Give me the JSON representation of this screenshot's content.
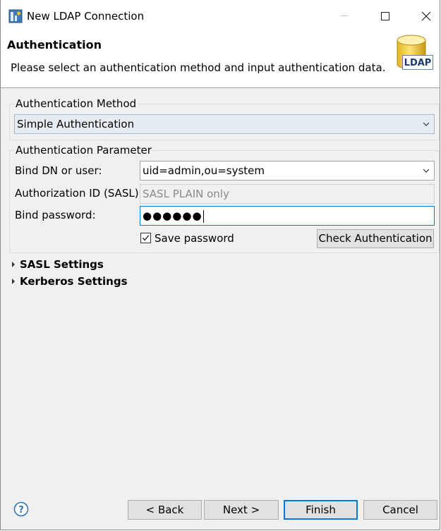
{
  "window": {
    "title": "New LDAP Connection"
  },
  "header": {
    "title": "Authentication",
    "description": "Please select an authentication method and input authentication data.",
    "logo_text": "LDAP"
  },
  "auth_method": {
    "group_label": "Authentication Method",
    "selected": "Simple Authentication"
  },
  "auth_params": {
    "group_label": "Authentication Parameter",
    "bind_dn_label": "Bind DN or user:",
    "bind_dn_value": "uid=admin,ou=system",
    "sasl_label": "Authorization ID (SASL):",
    "sasl_placeholder": "SASL PLAIN only",
    "password_label": "Bind password:",
    "password_value": "●●●●●●",
    "save_password_label": "Save password",
    "save_password_checked": true,
    "check_button_label": "Check Authentication"
  },
  "sections": {
    "sasl_label": "SASL Settings",
    "kerberos_label": "Kerberos Settings"
  },
  "footer": {
    "back_label": "< Back",
    "next_label": "Next >",
    "finish_label": "Finish",
    "cancel_label": "Cancel"
  },
  "colors": {
    "accent": "#0078d7",
    "combo_bg": "#e5ecf2",
    "dialog_bg": "#f0f0f0"
  },
  "icons": {
    "app": "ldap-connection-icon",
    "minimize": "minimize-icon",
    "maximize": "maximize-icon",
    "close": "close-icon",
    "help": "help-icon",
    "logo": "ldap-database-icon"
  }
}
